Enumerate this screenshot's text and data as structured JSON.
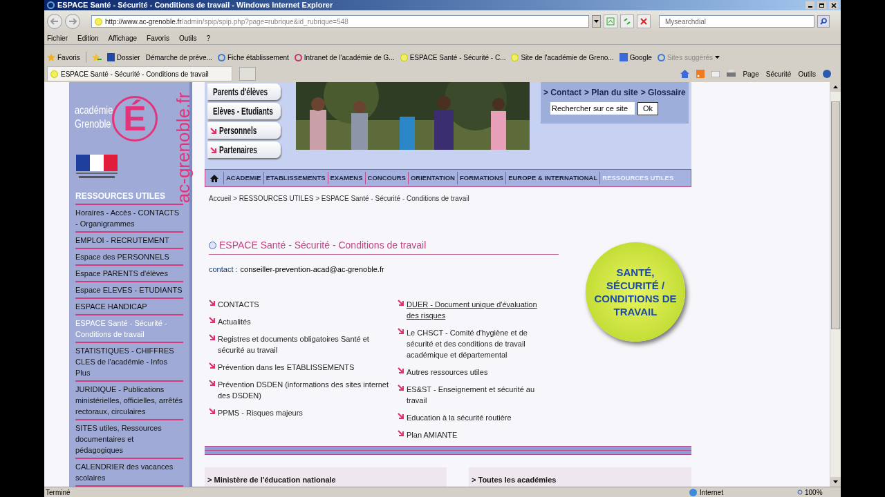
{
  "window": {
    "title": "ESPACE Santé - Sécurité - Conditions de travail - Windows Internet Explorer"
  },
  "address_bar": {
    "url_host": "http://www.ac-grenoble.fr",
    "url_path": "/admin/spip/spip.php?page=rubrique&id_rubrique=548"
  },
  "search": {
    "placeholder": "Mysearchdial"
  },
  "menu": [
    "Fichier",
    "Edition",
    "Affichage",
    "Favoris",
    "Outils",
    "?"
  ],
  "favorites_bar": {
    "label": "Favoris",
    "items": [
      {
        "kind": "folder",
        "label": "Dossier"
      },
      {
        "kind": "page",
        "label": "Démarche de préve..."
      },
      {
        "kind": "ie",
        "label": "Fiche établissement"
      },
      {
        "kind": "pink",
        "label": "Intranet de l'académie de G..."
      },
      {
        "kind": "site",
        "label": "ESPACE Santé - Sécurité - C..."
      },
      {
        "kind": "site",
        "label": "Site de l'académie de Greno..."
      },
      {
        "kind": "google",
        "label": "Google"
      },
      {
        "kind": "ie_grey",
        "label": "Sites suggérés"
      }
    ]
  },
  "tab": {
    "title": "ESPACE Santé - Sécurité - Conditions de travail"
  },
  "command_bar": [
    "Page",
    "Sécurité",
    "Outils"
  ],
  "logo": {
    "line1": "académie",
    "line2": "Grenoble",
    "letter": "É",
    "domain": "ac-grenoble.fr"
  },
  "audience_links": [
    "Parents d'élèves",
    "Elèves - Etudiants",
    "Personnels",
    "Partenaires"
  ],
  "top_links": [
    "> Contact",
    "> Plan du site",
    "> Glossaire"
  ],
  "site_search": {
    "value": "Rechercher sur ce site",
    "button": "Ok"
  },
  "nav": [
    {
      "label": "ACADEMIE",
      "selected": false
    },
    {
      "label": "ETABLISSEMENTS",
      "selected": false
    },
    {
      "label": "EXAMENS",
      "selected": false
    },
    {
      "label": "CONCOURS",
      "selected": false
    },
    {
      "label": "ORIENTATION",
      "selected": false
    },
    {
      "label": "FORMATIONS",
      "selected": false
    },
    {
      "label": "EUROPE & INTERNATIONAL",
      "selected": false
    },
    {
      "label": "RESSOURCES UTILES",
      "selected": true
    }
  ],
  "breadcrumb": "Accueil > RESSOURCES UTILES > ESPACE Santé - Sécurité - Conditions de travail",
  "sidebar": {
    "heading": "RESSOURCES UTILES",
    "items": [
      {
        "label": "Horaires - Accès - CONTACTS - Organigrammes",
        "selected": false
      },
      {
        "label": "EMPLOI - RECRUTEMENT",
        "selected": false
      },
      {
        "label": "Espace des PERSONNELS",
        "selected": false
      },
      {
        "label": "Espace PARENTS d'élèves",
        "selected": false
      },
      {
        "label": "Espace ELEVES - ETUDIANTS",
        "selected": false
      },
      {
        "label": "ESPACE HANDICAP",
        "selected": false
      },
      {
        "label": "ESPACE Santé - Sécurité - Conditions de travail",
        "selected": true
      },
      {
        "label": "STATISTIQUES - CHIFFRES CLES de l'académie - Infos Plus",
        "selected": false
      },
      {
        "label": "JURIDIQUE - Publications ministérielles, officielles, arrêtés rectoraux, circulaires",
        "selected": false
      },
      {
        "label": "SITES utiles, Ressources documentaires et pédagogiques",
        "selected": false
      },
      {
        "label": "CALENDRIER des vacances scolaires",
        "selected": false
      }
    ]
  },
  "article": {
    "title": "ESPACE Santé - Sécurité - Conditions de travail",
    "contact_label": "contact :",
    "contact_email": "conseiller-prevention-acad@ac-grenoble.fr"
  },
  "links_left": [
    {
      "label": "CONTACTS",
      "hovered": false
    },
    {
      "label": "Actualités",
      "hovered": false
    },
    {
      "label": "Registres et documents obligatoires Santé et sécurité au travail",
      "hovered": false
    },
    {
      "label": "Prévention dans les ETABLISSEMENTS",
      "hovered": false
    },
    {
      "label": "Prévention DSDEN (informations des sites internet des DSDEN)",
      "hovered": false
    },
    {
      "label": "PPMS - Risques majeurs",
      "hovered": false
    }
  ],
  "links_right": [
    {
      "label": "DUER - Document unique d'évaluation des risques",
      "hovered": true
    },
    {
      "label": "Le CHSCT - Comité d'hygiène et de sécurité et des conditions de travail académique et départemental",
      "hovered": false
    },
    {
      "label": "Autres ressources utiles",
      "hovered": false
    },
    {
      "label": "ES&ST - Enseignement et sécurité au travail",
      "hovered": false
    },
    {
      "label": "Education à la sécurité routière",
      "hovered": false
    },
    {
      "label": "Plan AMIANTE",
      "hovered": false
    }
  ],
  "badge": "SANTÉ, SÉCURITÉ / CONDITIONS DE TRAVAIL",
  "footer_boxes": [
    "> Ministère de l'éducation nationale",
    "> Toutes les académies"
  ],
  "status_bar": {
    "text": "Terminé",
    "zone": "Internet",
    "zoom": "100%"
  }
}
